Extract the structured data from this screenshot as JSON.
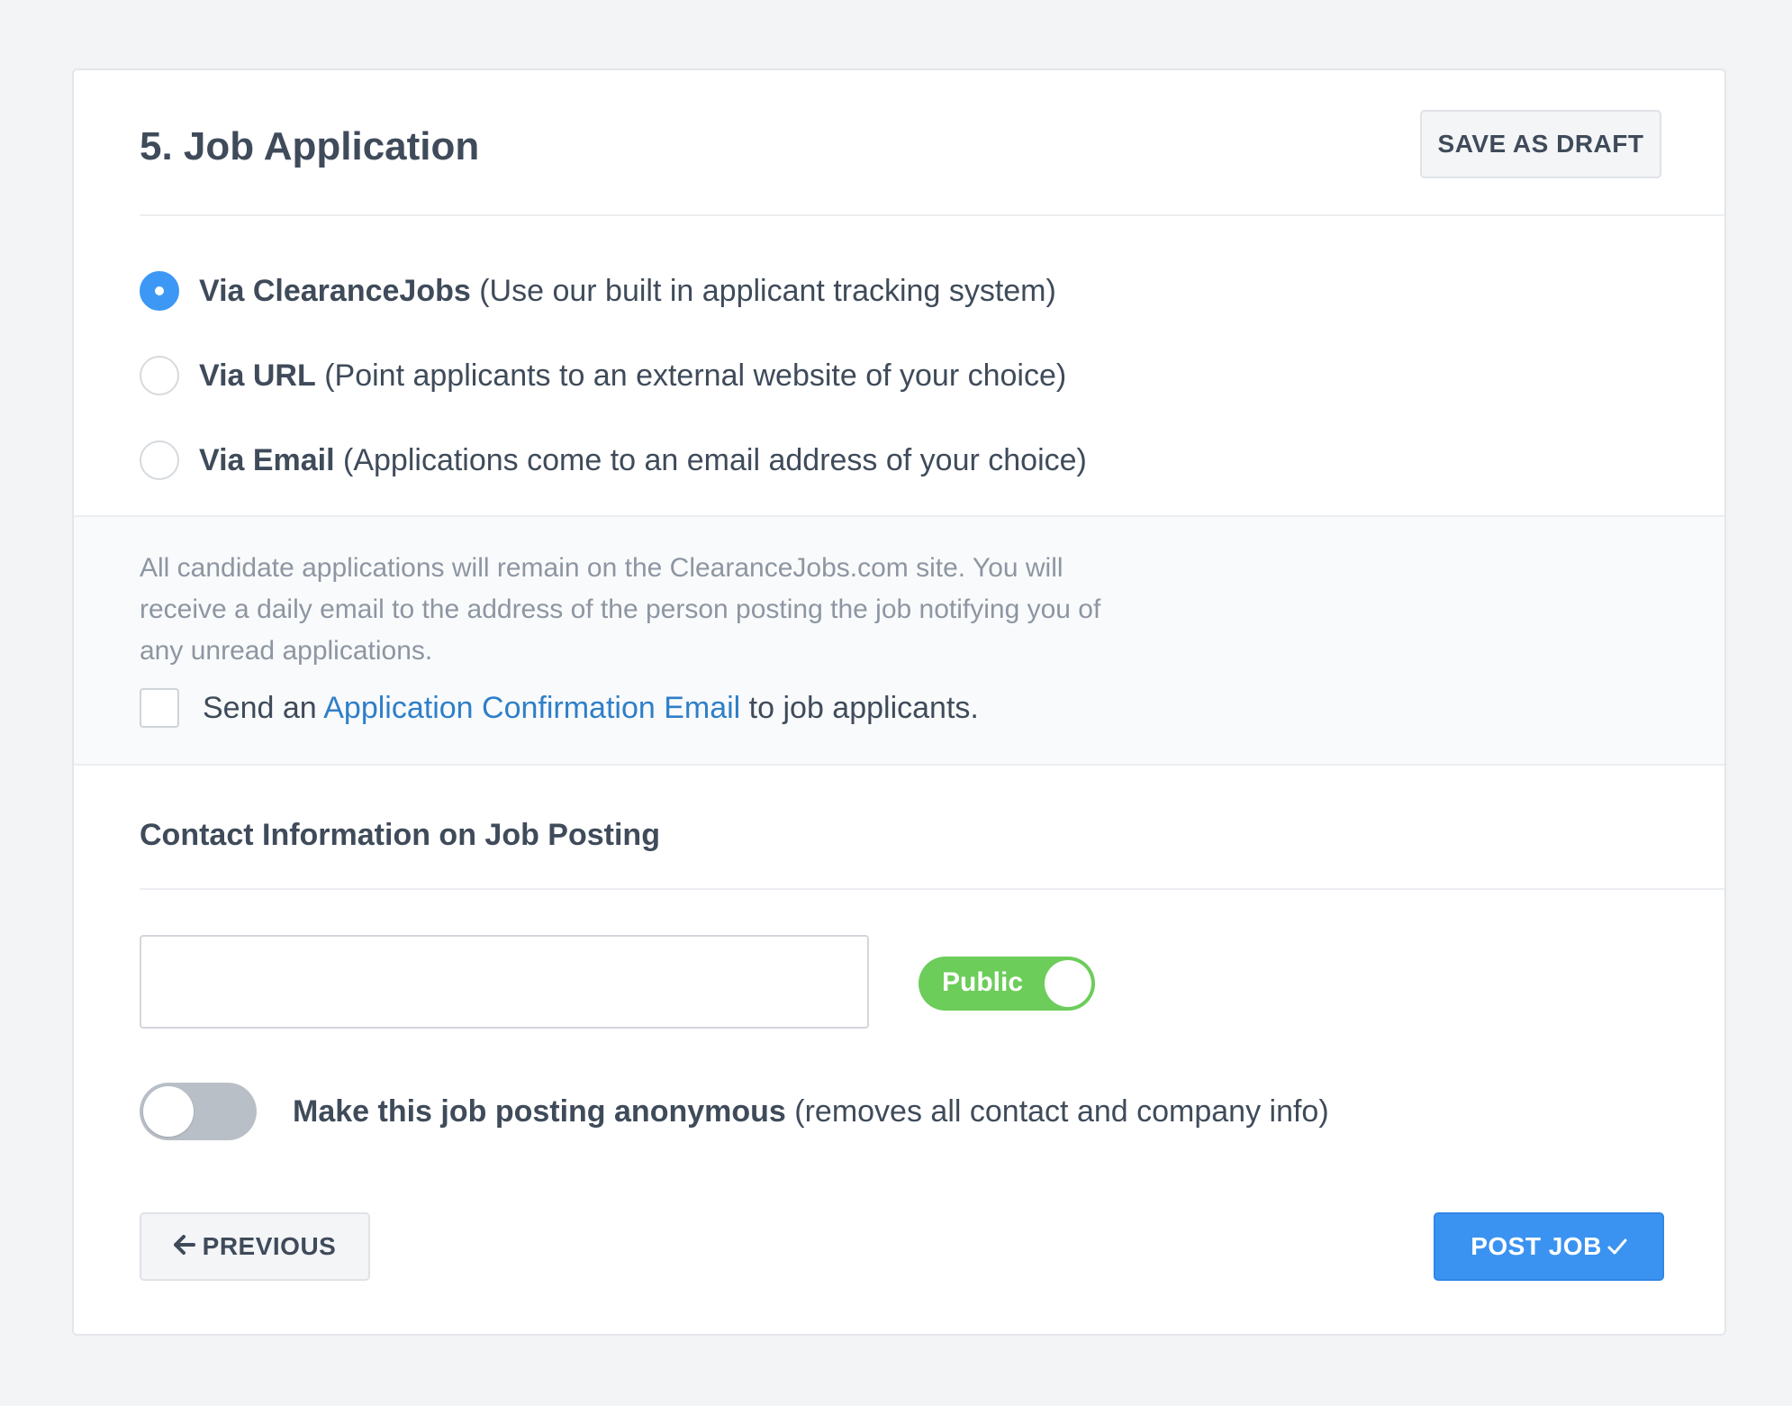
{
  "header": {
    "title": "5. Job Application",
    "save_draft_label": "SAVE AS DRAFT"
  },
  "application_methods": [
    {
      "bold": "Via ClearanceJobs",
      "desc": " (Use our built in applicant tracking system)",
      "selected": true
    },
    {
      "bold": "Via URL",
      "desc": " (Point applicants to an external website of your choice)",
      "selected": false
    },
    {
      "bold": "Via Email",
      "desc": " (Applications come to an email address of your choice)",
      "selected": false
    }
  ],
  "info": {
    "text": "All candidate applications will remain on the ClearanceJobs.com site. You will receive a daily email to the address of the person posting the job notifying you of any unread applications.",
    "confirm_prefix": "Send an ",
    "confirm_link": "Application Confirmation Email",
    "confirm_suffix": " to job applicants.",
    "confirm_checked": false
  },
  "contact": {
    "title": "Contact Information on Job Posting",
    "input_value": "",
    "visibility_label": "Public",
    "visibility_on": true
  },
  "anonymous": {
    "bold": "Make this job posting anonymous",
    "desc": " (removes all contact and company info)",
    "enabled": false
  },
  "footer": {
    "previous_icon": "arrow-left-icon",
    "previous_label": "PREVIOUS",
    "post_label": "POST JOB",
    "post_icon": "checkmark-icon"
  },
  "colors": {
    "accent": "#3b93f1",
    "toggle_on": "#6ccd5a",
    "link": "#2e7fc9"
  }
}
